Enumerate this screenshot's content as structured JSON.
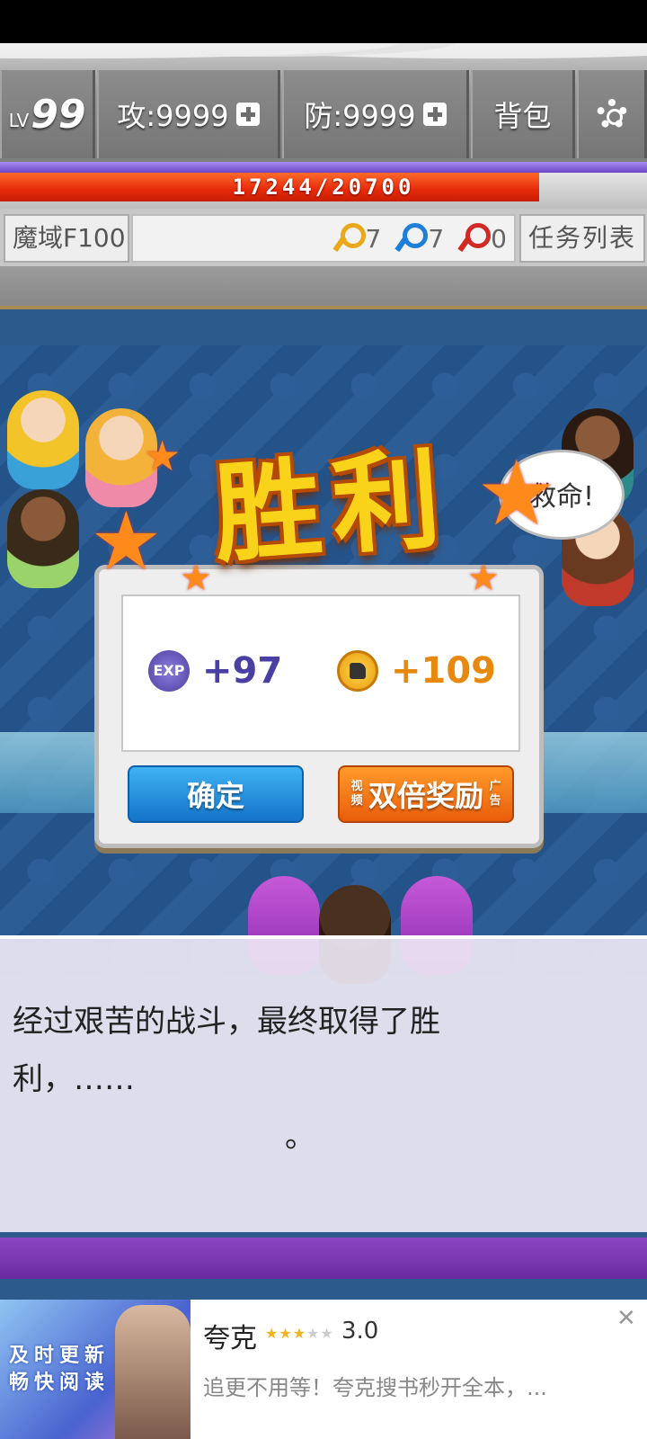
{
  "hud": {
    "level_prefix": "LV",
    "level": "99",
    "attack": "攻:9999",
    "defense": "防:9999",
    "bag": "背包"
  },
  "hp": {
    "text": "17244/20700",
    "current": 17244,
    "max": 20700
  },
  "info": {
    "floor": "魔域F100",
    "yellow_keys": "7",
    "blue_keys": "7",
    "red_keys": "0",
    "tasks": "任务列表"
  },
  "victory": {
    "title": "胜利",
    "bubble": "救命!",
    "exp_icon": "EXP",
    "exp": "+97",
    "gold": "+109",
    "confirm": "确定",
    "double_small_left": "视频",
    "double": "双倍奖励",
    "double_small_right": "广告"
  },
  "dialog": {
    "text": "经过艰苦的战斗，最终取得了胜利，……",
    "tail": "。"
  },
  "ad": {
    "promo_line1": "及时更新",
    "promo_line2": "畅快阅读",
    "title": "夸克",
    "rating": "3.0",
    "stars_on": "★★★",
    "stars_off": "★★",
    "description": "追更不用等！夸克搜书秒开全本，..."
  },
  "colors": {
    "hp_fill": "#e52a0a",
    "accent_purple": "#6d47c8"
  }
}
